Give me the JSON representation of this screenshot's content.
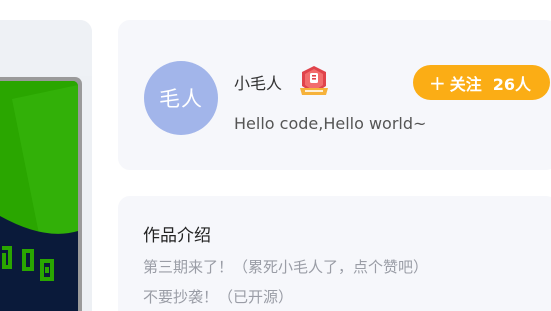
{
  "author": {
    "avatar_text": "毛人",
    "name": "小毛人",
    "bio": "Hello code,Hello world~",
    "badge_icon": "medal-badge-icon",
    "follow": {
      "plus_icon": "+",
      "label": "关注",
      "count": "26人"
    }
  },
  "intro": {
    "title": "作品介绍",
    "lines": [
      "第三期来了！（累死小毛人了，点个赞吧）",
      "不要抄袭！（已开源）"
    ]
  },
  "colors": {
    "follow_button": "#fbad15",
    "avatar_bg": "#a2b5ea",
    "card_bg": "#f6f7fb",
    "preview_green": "#2aa600",
    "preview_navy": "#0a1a3a"
  }
}
